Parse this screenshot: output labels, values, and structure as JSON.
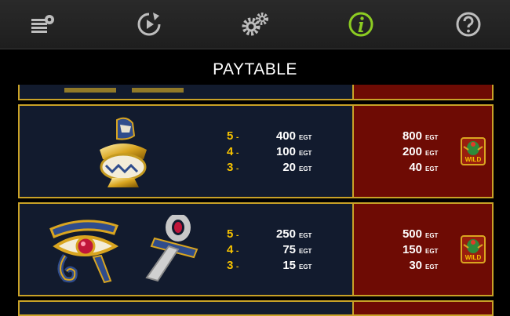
{
  "toolbar": {
    "buttons": [
      {
        "icon": "settings-list-icon"
      },
      {
        "icon": "autoplay-icon"
      },
      {
        "icon": "gears-icon"
      },
      {
        "icon": "info-icon",
        "active": true
      },
      {
        "icon": "help-icon"
      }
    ],
    "active_color": "#8ccc22",
    "icon_color": "#bdbdbd"
  },
  "title": "PAYTABLE",
  "currency": "EGT",
  "rows": [
    {
      "symbols": [
        "canopic-jar"
      ],
      "pays": [
        {
          "count": "5",
          "dot": "-",
          "value": "400"
        },
        {
          "count": "4",
          "dot": "-",
          "value": "100"
        },
        {
          "count": "3",
          "dot": "-",
          "value": "20"
        }
      ],
      "wild_pays": [
        "800",
        "200",
        "40"
      ]
    },
    {
      "symbols": [
        "eye-of-horus",
        "ankh"
      ],
      "pays": [
        {
          "count": "5",
          "dot": "-",
          "value": "250"
        },
        {
          "count": "4",
          "dot": "-",
          "value": "75"
        },
        {
          "count": "3",
          "dot": "-",
          "value": "15"
        }
      ],
      "wild_pays": [
        "500",
        "150",
        "30"
      ]
    }
  ],
  "wild_label": "WILD"
}
